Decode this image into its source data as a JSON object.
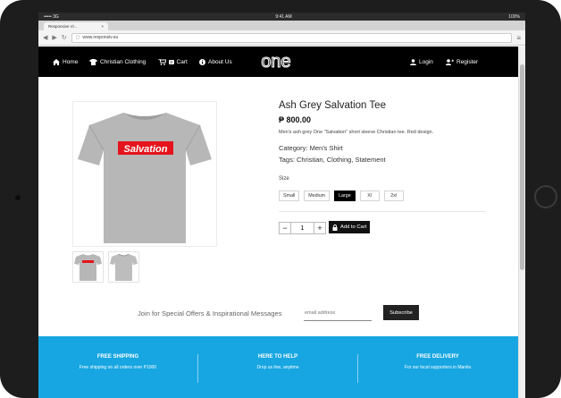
{
  "status_bar": {
    "signal": "••••• 3G",
    "time": "9:41 AM",
    "battery": "100%"
  },
  "browser": {
    "tab_title": "Responsive Vi...",
    "url": "www.responsiv.eu"
  },
  "nav": {
    "home": "Home",
    "christian_clothing": "Christian Clothing",
    "cart": "Cart",
    "cart_count": "0",
    "about": "About Us",
    "logo": "one",
    "login": "Login",
    "register": "Register"
  },
  "product": {
    "image_text": "Salvation",
    "title": "Ash Grey Salvation Tee",
    "price": "₱ 800.00",
    "description": "Men's ash grey One \"Salvation\" short sleeve Christian tee. Red design.",
    "category": "Category: Men's Shirt",
    "tags": "Tags: Christian, Clothing, Statement",
    "size_label": "Size",
    "sizes": [
      "Small",
      "Medium",
      "Large",
      "Xl",
      "2xl"
    ],
    "selected_size": "Large",
    "quantity": "1",
    "add_to_cart": "Add to Cart"
  },
  "newsletter": {
    "text": "Join for Special Offers & Inspirational Messages",
    "placeholder": "email address",
    "button": "Subscribe"
  },
  "footer": {
    "items": [
      {
        "heading": "FREE SHIPPING",
        "text": "Free shipping on all orders over P1000"
      },
      {
        "heading": "HERE TO HELP",
        "text": "Drop us line, anytime"
      },
      {
        "heading": "FREE DELIVERY",
        "text": "For our local supporters in Manila"
      }
    ]
  },
  "colors": {
    "accent": "#17a6e2",
    "nav_bg": "#000000",
    "logo_red": "#e3141c"
  }
}
